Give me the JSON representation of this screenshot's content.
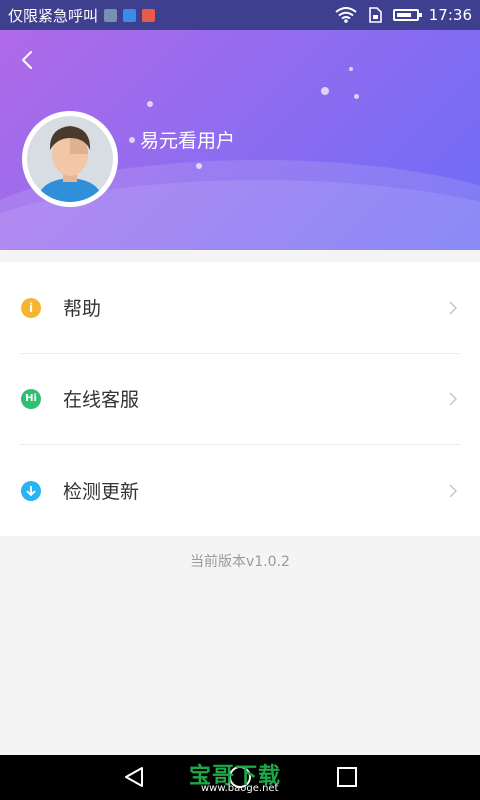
{
  "status_bar": {
    "carrier_text": "仅限紧急呼叫",
    "time": "17:36",
    "icons": [
      "notification-image-icon",
      "notification-app-icon",
      "notification-blocked-icon",
      "wifi-icon",
      "sim-icon",
      "battery-icon"
    ]
  },
  "header": {
    "back_icon": "chevron-left-icon",
    "username": "易元看用户",
    "gradient_colors": [
      "#b06ae8",
      "#8a6cf1",
      "#6c6cf5"
    ]
  },
  "menu": {
    "items": [
      {
        "label": "帮助",
        "icon": "info-icon",
        "icon_color": "#f5b52e"
      },
      {
        "label": "在线客服",
        "icon": "chat-hi-icon",
        "icon_color": "#2fbf71"
      },
      {
        "label": "检测更新",
        "icon": "download-arrow-icon",
        "icon_color": "#28b4f0"
      }
    ]
  },
  "footer": {
    "version_text": "当前版本v1.0.2"
  },
  "nav_bar": {
    "buttons": [
      "back-triangle-icon",
      "home-circle-icon",
      "recents-square-icon"
    ],
    "watermark": "宝哥下载",
    "watermark_url": "www.baoge.net"
  }
}
